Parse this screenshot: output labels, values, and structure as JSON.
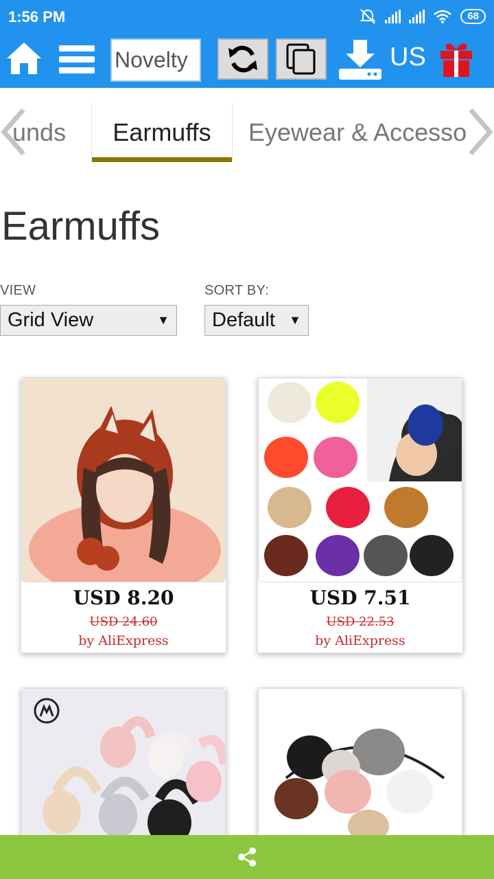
{
  "status_bar": {
    "time": "1:56 PM",
    "battery": "68",
    "icons": [
      "alarm-off-icon",
      "signal-icon",
      "signal-icon",
      "wifi-icon",
      "battery-icon"
    ]
  },
  "toolbar": {
    "icons": [
      "home-icon",
      "menu-icon",
      "refresh-icon",
      "copy-icon",
      "download-icon",
      "gift-icon"
    ],
    "category_select": "Novelty",
    "country": "US",
    "colors": {
      "bar": "#2193ee",
      "gift": "#e0141e"
    }
  },
  "tabs": {
    "prev_partial": "unds",
    "active": "Earmuffs",
    "next": "Eyewear & Accesso",
    "active_underline": "#8a7500"
  },
  "page": {
    "title": "Earmuffs",
    "view_label": "VIEW",
    "view_value": "Grid View",
    "sort_label": "SORT BY:",
    "sort_value": "Default"
  },
  "products": [
    {
      "price": "USD 8.20",
      "old_price": "USD 24.60",
      "seller": "by AliExpress",
      "image": "red knit fox-ear hat photo"
    },
    {
      "price": "USD 7.51",
      "old_price": "USD 22.53",
      "seller": "by AliExpress",
      "image": "colorful earmuffs grid photo"
    },
    {
      "image": "plush earmuffs photo"
    },
    {
      "image": "fur earmuffs photo"
    }
  ],
  "share_bar": {
    "icon": "share-icon",
    "color": "#8dc73f"
  }
}
